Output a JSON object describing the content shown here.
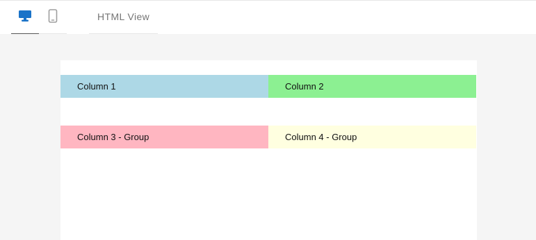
{
  "toolbar": {
    "tabs": [
      {
        "icon": "desktop-icon",
        "active": true,
        "color": "#1a73c8"
      },
      {
        "icon": "mobile-phone-icon",
        "active": false,
        "color": "#9e9e9e"
      },
      {
        "label": "HTML View",
        "active": false
      }
    ]
  },
  "preview": {
    "rows": [
      {
        "cells": [
          {
            "label": "Column 1",
            "color": "#add8e6"
          },
          {
            "label": "Column 2",
            "color": "#8cf092"
          }
        ]
      },
      {
        "cells": [
          {
            "label": "Column 3 - Group",
            "color": "#ffb6c1"
          },
          {
            "label": "Column 4 - Group",
            "color": "#ffffe0"
          }
        ]
      }
    ]
  }
}
